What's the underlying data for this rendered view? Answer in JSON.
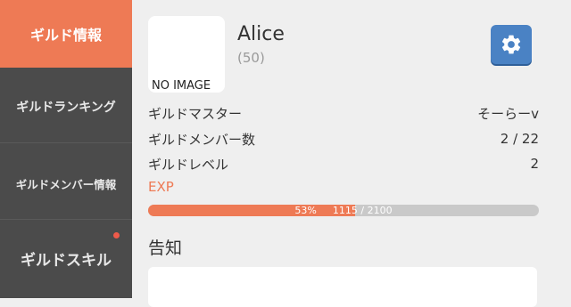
{
  "sidebar": {
    "items": [
      {
        "label": "ギルド情報",
        "active": true
      },
      {
        "label": "ギルドランキング",
        "active": false
      },
      {
        "label": "ギルドメンバー情報",
        "active": false
      },
      {
        "label": "ギルドスキル",
        "active": false,
        "badge": true
      }
    ]
  },
  "guild": {
    "thumbnail_text": "NO IMAGE",
    "name": "Alice",
    "level_text": "(50)",
    "settings_icon": "gear-icon",
    "rows": [
      {
        "label": "ギルドマスター",
        "value": "そーらーv"
      },
      {
        "label": "ギルドメンバー数",
        "value": "2 / 22"
      },
      {
        "label": "ギルドレベル",
        "value": "2"
      }
    ]
  },
  "exp": {
    "label": "EXP",
    "percent_text": "53%",
    "progress": 0.53,
    "current": "1115",
    "max": "2100"
  },
  "notice": {
    "title": "告知"
  },
  "colors": {
    "accent": "#ee7a55",
    "sidebar_bg": "#4b4b4b",
    "settings_button": "#4a82c4"
  }
}
